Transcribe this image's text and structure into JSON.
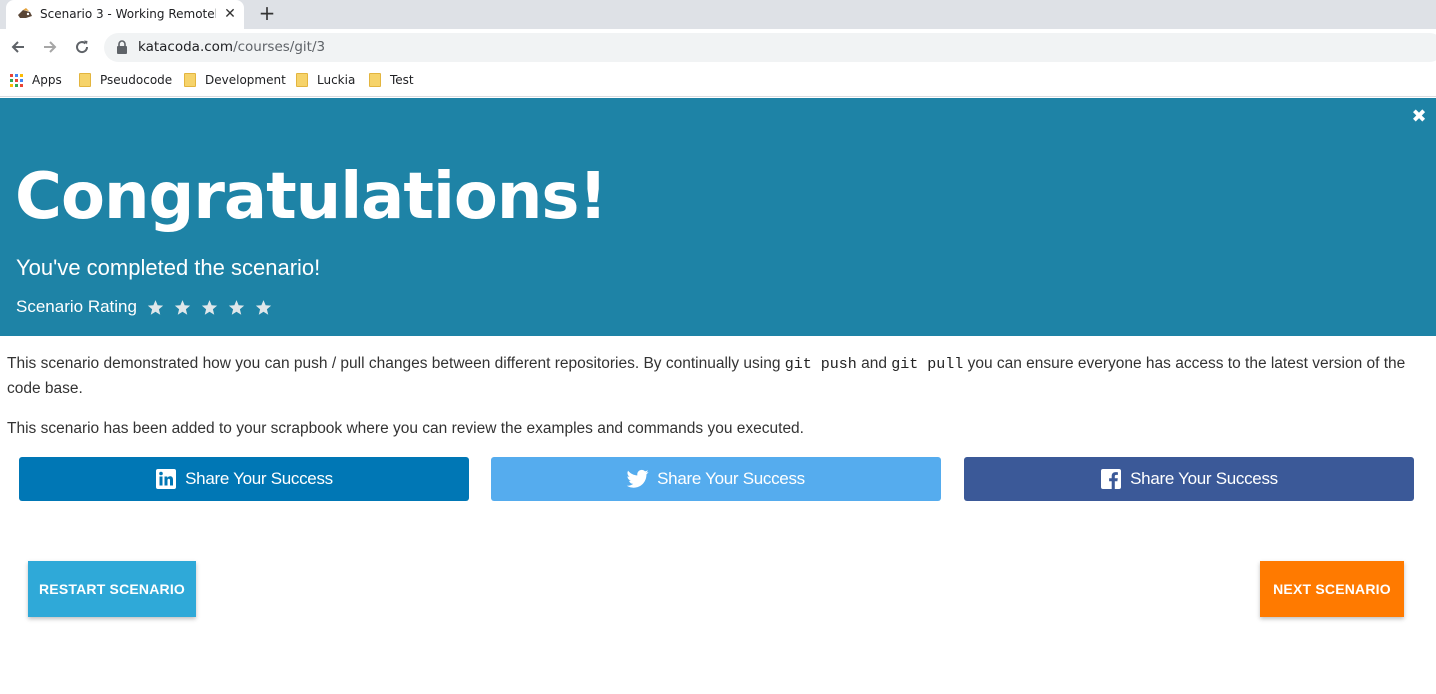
{
  "browser": {
    "tab_title": "Scenario 3 - Working Remotely |",
    "tab_close": "✕",
    "new_tab": "+",
    "url_domain": "katacoda.com",
    "url_path": "/courses/git/3",
    "bookmarks": [
      {
        "label": "Apps",
        "icon": "apps-grid-icon"
      },
      {
        "label": "Pseudocode",
        "icon": "folder-icon"
      },
      {
        "label": "Development",
        "icon": "folder-icon"
      },
      {
        "label": "Luckia",
        "icon": "folder-icon"
      },
      {
        "label": "Test",
        "icon": "folder-icon"
      }
    ]
  },
  "hero": {
    "title": "Congratulations!",
    "subtitle": "You've completed the scenario!",
    "rating_label": "Scenario Rating",
    "stars": 5,
    "background": "#1e83a6",
    "close": "✖"
  },
  "content": {
    "p1_before": "This scenario demonstrated how you can push / pull changes between different repositories. By continually using ",
    "p1_code1": "git push",
    "p1_mid": " and ",
    "p1_code2": "git pull",
    "p1_after": " you can ensure everyone has access to the latest version of the code base.",
    "p2": "This scenario has been added to your scrapbook where you can review the examples and commands you executed."
  },
  "share": {
    "linkedin": {
      "label": "Share Your Success",
      "color": "#0077b5",
      "icon": "linkedin-icon"
    },
    "twitter": {
      "label": "Share Your Success",
      "color": "#55acee",
      "icon": "twitter-icon"
    },
    "facebook": {
      "label": "Share Your Success",
      "color": "#3b5998",
      "icon": "facebook-icon"
    }
  },
  "actions": {
    "restart": {
      "label": "RESTART SCENARIO",
      "color": "#2fa9d8"
    },
    "next": {
      "label": "NEXT SCENARIO",
      "color": "#ff7a00"
    }
  }
}
